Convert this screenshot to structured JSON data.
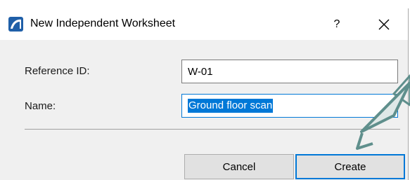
{
  "dialog": {
    "title": "New Independent Worksheet",
    "help_label": "?",
    "close_icon": "close-icon",
    "app_icon": "archicad-app-icon"
  },
  "form": {
    "reference_id": {
      "label": "Reference ID:",
      "value": "W-01"
    },
    "name": {
      "label": "Name:",
      "value": "Ground floor scan"
    }
  },
  "buttons": {
    "cancel": "Cancel",
    "create": "Create"
  },
  "colors": {
    "accent": "#0078d7",
    "callout": "#5f8f8c"
  }
}
